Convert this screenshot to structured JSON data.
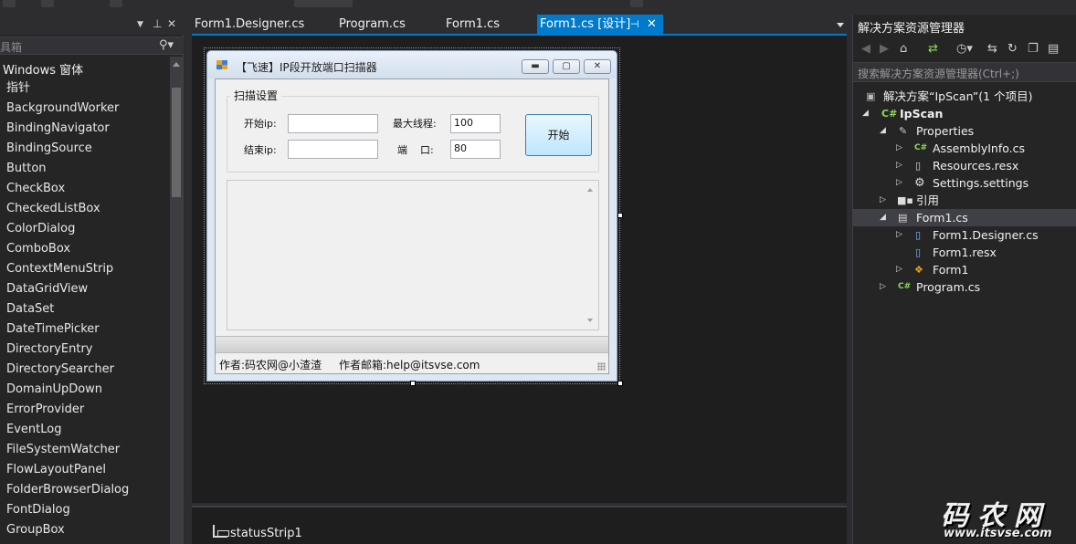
{
  "toolbox": {
    "search_placeholder": "具箱",
    "group_label": "Windows 窗体",
    "items": [
      "指针",
      "BackgroundWorker",
      "BindingNavigator",
      "BindingSource",
      "Button",
      "CheckBox",
      "CheckedListBox",
      "ColorDialog",
      "ComboBox",
      "ContextMenuStrip",
      "DataGridView",
      "DataSet",
      "DateTimePicker",
      "DirectoryEntry",
      "DirectorySearcher",
      "DomainUpDown",
      "ErrorProvider",
      "EventLog",
      "FileSystemWatcher",
      "FlowLayoutPanel",
      "FolderBrowserDialog",
      "FontDialog",
      "GroupBox"
    ]
  },
  "tabs": [
    {
      "label": "Form1.Designer.cs",
      "active": false
    },
    {
      "label": "Program.cs",
      "active": false
    },
    {
      "label": "Form1.cs",
      "active": false
    },
    {
      "label": "Form1.cs [设计]",
      "active": true
    }
  ],
  "form": {
    "title": "【飞速】IP段开放端口扫描器",
    "group_title": "扫描设置",
    "start_ip_label": "开始ip:",
    "start_ip_value": "",
    "end_ip_label": "结束ip:",
    "end_ip_value": "",
    "max_threads_label": "最大线程:",
    "max_threads_value": "100",
    "port_label": "端    口:",
    "port_value": "80",
    "start_button": "开始",
    "status_author": "作者:码农网@小渣渣",
    "status_email": "作者邮箱:help@itsvse.com"
  },
  "component_tray": {
    "items": [
      "statusStrip1"
    ]
  },
  "solution_explorer": {
    "title": "解决方案资源管理器",
    "search_placeholder": "搜索解决方案资源管理器(Ctrl+;)",
    "tree": {
      "solution": "解决方案“IpScan”(1 个项目)",
      "project": "IpScan",
      "properties": "Properties",
      "assembly_info": "AssemblyInfo.cs",
      "resources": "Resources.resx",
      "settings": "Settings.settings",
      "references": "引用",
      "form1": "Form1.cs",
      "form1_designer": "Form1.Designer.cs",
      "form1_resx": "Form1.resx",
      "form1_class": "Form1",
      "program": "Program.cs"
    }
  },
  "watermark": {
    "big": "码农网",
    "small": "www.itsvse.com"
  },
  "colors": {
    "accent": "#007acc",
    "background": "#2d2d30",
    "csharp_icon": "#8fd85a"
  }
}
